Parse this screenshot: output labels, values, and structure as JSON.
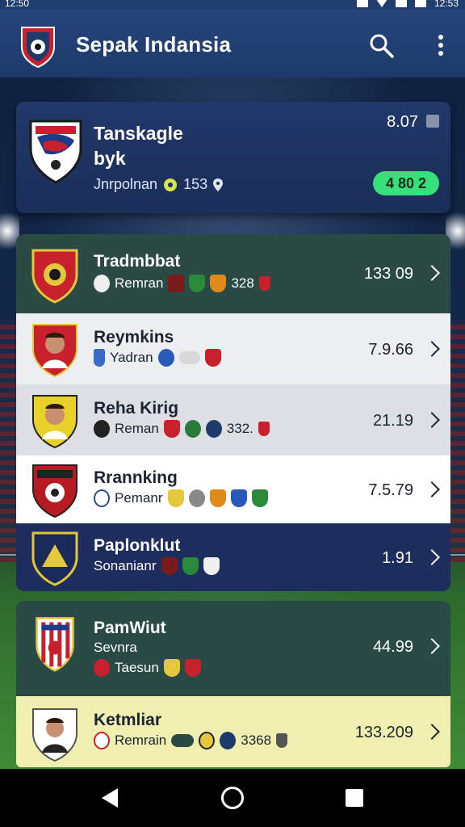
{
  "status_bar": {
    "time": "12:50",
    "clock_right": "12:53"
  },
  "app_bar": {
    "title": "Sepak Indansia"
  },
  "featured": {
    "title_line1": "Tanskagle",
    "title_line2": "byk",
    "meta_text": "Jnrpolnan",
    "meta_count": "153",
    "score": "8.07",
    "pill": "4 80 2"
  },
  "rows": [
    {
      "name": "Tradmbbat",
      "sub": "Remran",
      "extra": "328",
      "value": "133 09",
      "theme": "dark"
    },
    {
      "name": "Reymkins",
      "sub": "Yadran",
      "extra": "",
      "value": "7.9.66",
      "theme": "light"
    },
    {
      "name": "Reha Kirig",
      "sub": "Reman",
      "extra": "332.",
      "value": "21.19",
      "theme": "light2"
    },
    {
      "name": "Rrannking",
      "sub": "Pemanr",
      "extra": "",
      "value": "7.5.79",
      "theme": "white"
    },
    {
      "name": "Paplonklut",
      "sub": "Sonanianr",
      "extra": "",
      "value": "1.91",
      "theme": "navy"
    },
    {
      "name": "PamWiut",
      "name2": "Sevnra",
      "sub": "Taesun",
      "extra": "",
      "value": "44.99",
      "theme": "green"
    },
    {
      "name": "Ketmliar",
      "sub": "Remrain",
      "extra": "3368",
      "value": "133.209",
      "theme": "yellow"
    }
  ],
  "colors": {
    "accent_green": "#37e07a",
    "app_bar": "#1d3a6b",
    "chevron_green": "#3ed07c"
  }
}
